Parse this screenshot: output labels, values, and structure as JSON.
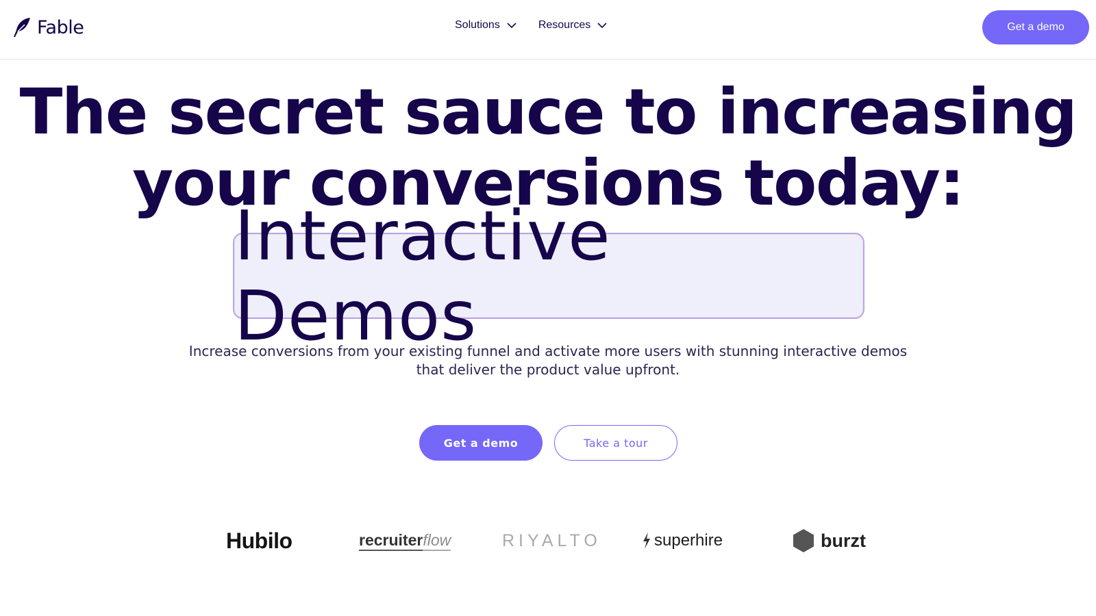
{
  "header": {
    "brand": "Fable",
    "nav": [
      {
        "label": "Solutions",
        "icon": "chevron-down-icon"
      },
      {
        "label": "Resources",
        "icon": "chevron-down-icon"
      }
    ],
    "cta_label": "Get a demo"
  },
  "hero": {
    "title_line1": "The secret sauce to increasing",
    "title_line2": "your conversions today:",
    "highlight": "Interactive Demos",
    "subtitle": "Increase conversions from your existing funnel and activate more users with stunning interactive demos that deliver the product value upfront.",
    "primary_cta": "Get a demo",
    "secondary_cta": "Take a tour"
  },
  "clients": {
    "hubilo": "Hubilo",
    "recruiter_part1": "recruiter",
    "recruiter_part2": "flow",
    "riyalto": "RIYALTO",
    "superhire": "superhire",
    "burzt": "burzt"
  },
  "colors": {
    "accent": "#7567f8",
    "heading": "#16054a",
    "highlight_bg": "#efeffc",
    "grid_blue": "#8f86f0",
    "grid_orange": "#f7b58a"
  }
}
